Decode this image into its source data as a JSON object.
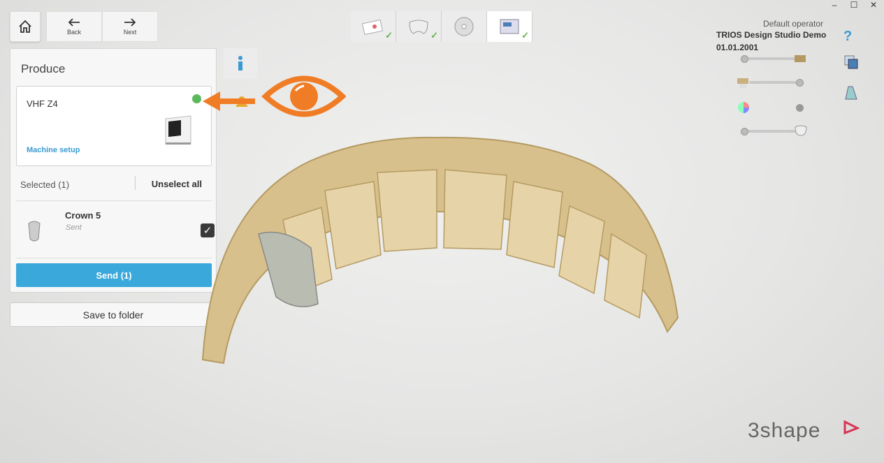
{
  "window": {
    "minimize": "–",
    "maximize": "☐",
    "close": "✕"
  },
  "nav": {
    "back": "Back",
    "next": "Next"
  },
  "panel": {
    "title": "Produce",
    "machine": {
      "name": "VHF Z4",
      "status_color": "#5cb85c",
      "setup_link": "Machine setup"
    },
    "selected": "Selected (1)",
    "unselect": "Unselect all",
    "items": [
      {
        "name": "Crown 5",
        "status": "Sent",
        "checked": true
      }
    ],
    "send": "Send (1)"
  },
  "save": "Save to folder",
  "info": {
    "operator": "Default operator",
    "project": "TRIOS Design Studio Demo",
    "date": "01.01.2001"
  },
  "brand": "3shape",
  "colors": {
    "accent": "#3aa8db",
    "annotation": "#f07d26",
    "status_ok": "#5cb85c"
  }
}
